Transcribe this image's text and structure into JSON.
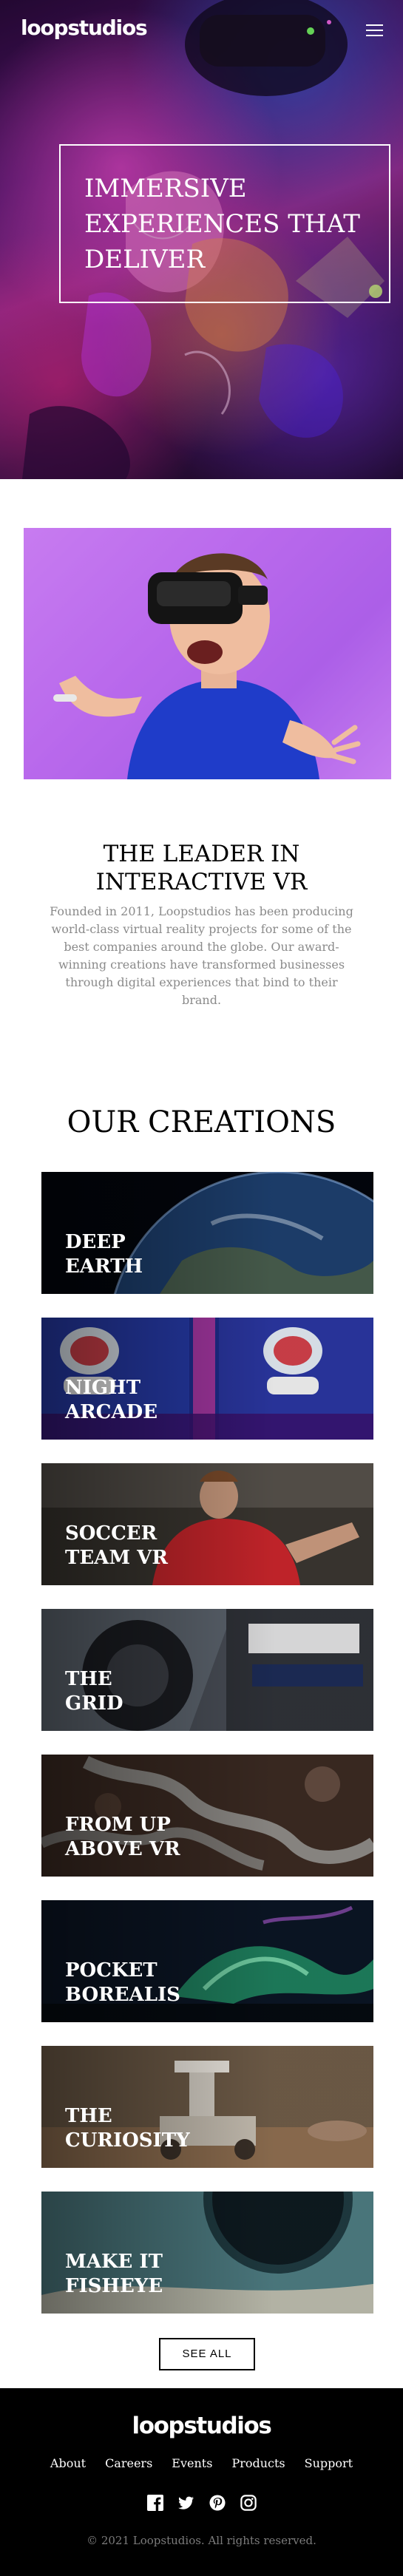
{
  "header": {
    "logo": "loopstudios",
    "menu_icon": "hamburger-menu-icon"
  },
  "hero": {
    "heading": "Immersive\nexperiences that\ndeliver"
  },
  "about": {
    "heading": "The leader in\ninteractive VR",
    "text": "Founded in 2011, Loopstudios has been producing world-class virtual reality projects for some of the best companies around the globe. Our award-winning creations have transformed businesses through digital experiences that bind to their brand."
  },
  "creations": {
    "heading": "Our creations",
    "items": [
      {
        "title": "Deep\nearth"
      },
      {
        "title": "Night\narcade"
      },
      {
        "title": "Soccer\nteam VR"
      },
      {
        "title": "The\ngrid"
      },
      {
        "title": "From up\nabove VR"
      },
      {
        "title": "Pocket\nborealis"
      },
      {
        "title": "The\ncuriosity"
      },
      {
        "title": "Make it\nfisheye"
      }
    ],
    "see_all": "See all"
  },
  "footer": {
    "logo": "loopstudios",
    "nav": [
      "About",
      "Careers",
      "Events",
      "Products",
      "Support"
    ],
    "social": [
      "facebook-icon",
      "twitter-icon",
      "pinterest-icon",
      "instagram-icon"
    ],
    "copyright": "© 2021 Loopstudios. All rights reserved."
  },
  "colors": {
    "text_dark": "#000000",
    "text_muted": "#8a8a8a",
    "footer_bg": "#000000",
    "footer_text": "#ffffff",
    "copyright": "#7b7b7b"
  }
}
